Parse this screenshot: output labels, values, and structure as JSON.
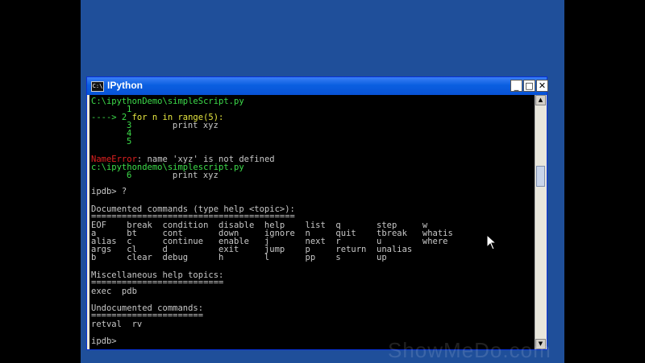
{
  "window": {
    "title": "IPython",
    "icon": "console-icon",
    "icon_glyph": "C:\\"
  },
  "controls": {
    "minimize": "_",
    "maximize": "□",
    "close": "✕"
  },
  "console": {
    "path1": "C:\\ipythonDemo\\simpleScript.py",
    "l1": "1",
    "arrow": "----> 2 ",
    "code2": "for n in range(5):",
    "l3": "3",
    "code3": "        print xyz",
    "l4": "4",
    "l5": "5",
    "err_name": "NameError",
    "err_msg": ": name 'xyz' is not defined",
    "path2": "c:\\ipythondemo\\simplescript.py",
    "l6": "6",
    "code6": "        print xyz",
    "prompt1": "ipdb> ?",
    "doc_header": "Documented commands (type help <topic>):",
    "doc_rule": "========================================",
    "doc_rows": [
      "EOF    break  condition  disable  help    list  q       step     w",
      "a      bt     cont       down     ignore  n     quit    tbreak   whatis",
      "alias  c      continue   enable   j       next  r       u        where",
      "args   cl     d          exit     jump    p     return  unalias",
      "b      clear  debug      h        l       pp    s       up"
    ],
    "misc_header": "Miscellaneous help topics:",
    "misc_rule": "==========================",
    "misc_items": "exec  pdb",
    "undoc_header": "Undocumented commands:",
    "undoc_rule": "======================",
    "undoc_items": "retval  rv",
    "prompt2": "ipdb> "
  },
  "scrollbar": {
    "up": "▲",
    "down": "▼"
  },
  "watermark": "ShowMeDo.com",
  "colors": {
    "green": "#3ddc4a",
    "yellow": "#e6e640",
    "red": "#e02020",
    "text": "#c8c8c8"
  }
}
